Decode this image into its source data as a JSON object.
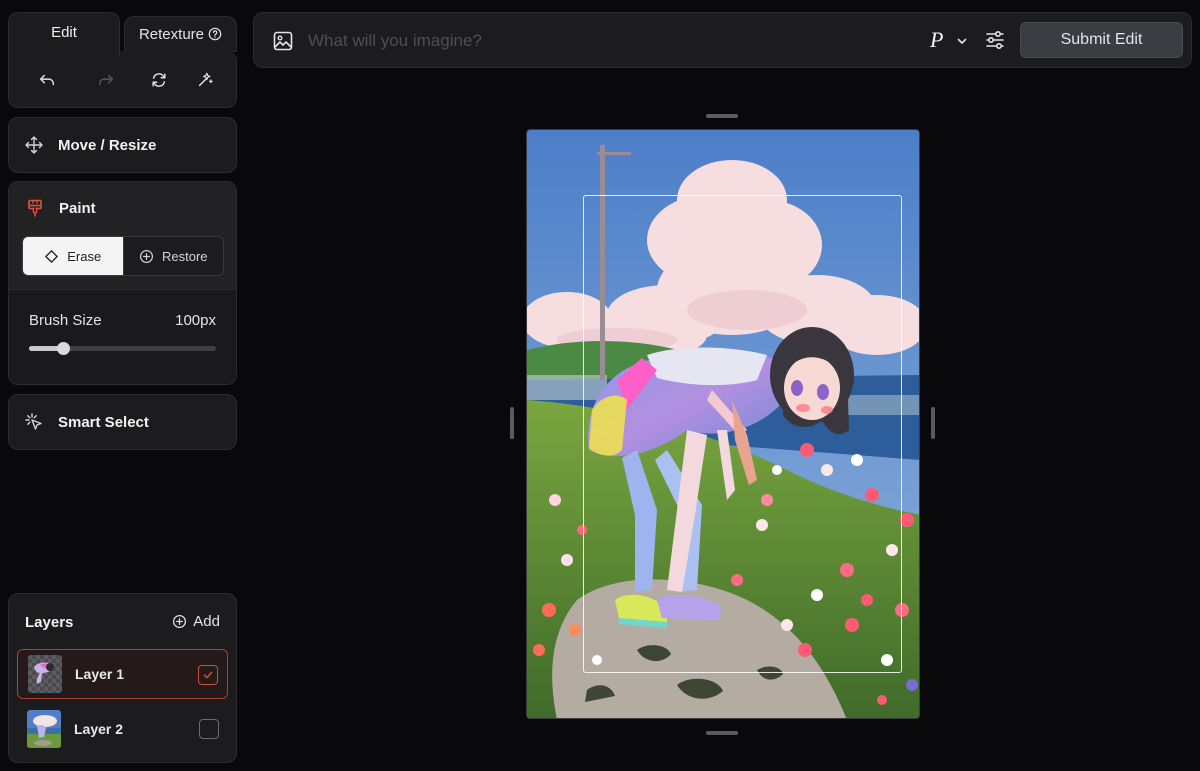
{
  "tabs": {
    "edit": "Edit",
    "retexture": "Retexture"
  },
  "tools": {
    "move_resize": "Move / Resize",
    "paint": "Paint",
    "erase": "Erase",
    "restore": "Restore",
    "brush_size_label": "Brush Size",
    "brush_size_value": "100px",
    "brush_size_fraction": 0.18,
    "smart_select": "Smart Select"
  },
  "layers": {
    "title": "Layers",
    "add": "Add",
    "items": [
      {
        "label": "Layer 1",
        "checked": true
      },
      {
        "label": "Layer 2",
        "checked": false
      }
    ]
  },
  "prompt": {
    "placeholder": "What will you imagine?",
    "model_glyph": "P",
    "submit": "Submit Edit"
  },
  "colors": {
    "accent_red": "#d14b3a",
    "panel": "#1c1c1f",
    "background": "#09090b"
  }
}
